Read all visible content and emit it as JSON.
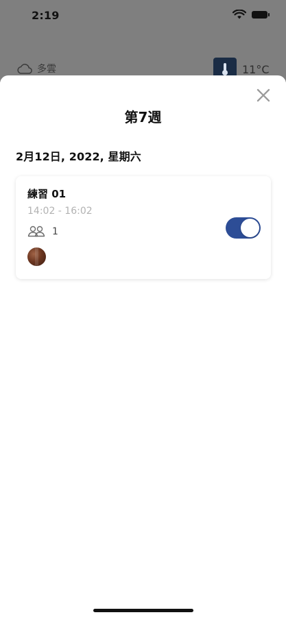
{
  "status_bar": {
    "time": "2:19"
  },
  "background_screen": {
    "weather_label": "多雲",
    "temperature": "11°C"
  },
  "sheet": {
    "title": "第7週",
    "date": "2月12日, 2022, 星期六"
  },
  "session": {
    "title": "練習 01",
    "time_range": "14:02 - 16:02",
    "participant_count": "1",
    "toggle_on": true
  },
  "colors": {
    "toggle_on": "#2d4d96",
    "overlay": "#7f7f7f",
    "muted_text": "#b2b2b2"
  },
  "icons": {
    "close": "close-icon",
    "participants": "participants-icon",
    "weather": "cloud-icon",
    "temperature": "thermometer-icon",
    "wifi": "wifi-icon",
    "battery": "battery-icon"
  }
}
